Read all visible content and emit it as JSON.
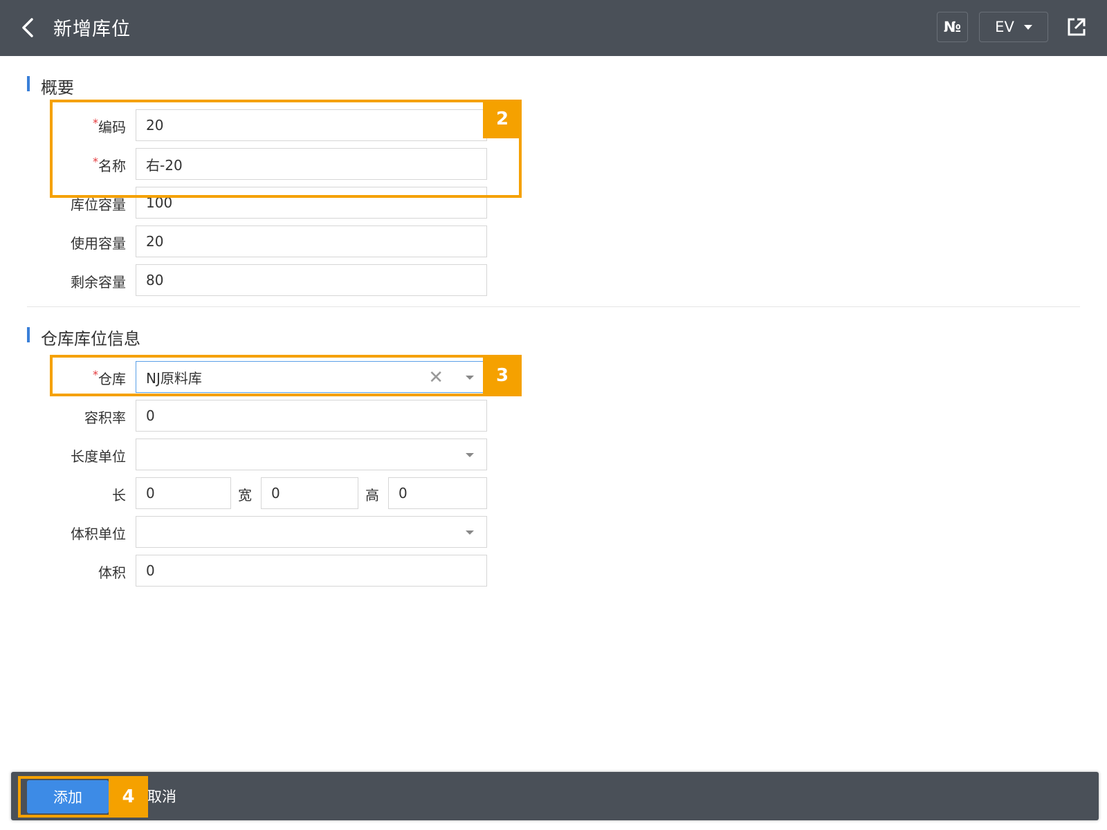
{
  "header": {
    "title": "新增库位",
    "no_button": "№",
    "ev_button": "EV",
    "back_icon": "chevron-left-icon",
    "share_icon": "share-icon"
  },
  "summary": {
    "title": "概要",
    "code": {
      "label": "编码",
      "required": "*",
      "value": "20"
    },
    "name": {
      "label": "名称",
      "required": "*",
      "value": "右-20"
    },
    "capacity": {
      "label": "库位容量",
      "value": "100"
    },
    "used_capacity": {
      "label": "使用容量",
      "value": "20"
    },
    "remaining_capacity": {
      "label": "剩余容量",
      "value": "80"
    }
  },
  "warehouse_info": {
    "title": "仓库库位信息",
    "warehouse": {
      "label": "仓库",
      "required": "*",
      "value": "NJ原料库",
      "clear": "✕"
    },
    "volume_ratio": {
      "label": "容积率",
      "value": "0"
    },
    "length_unit": {
      "label": "长度单位",
      "value": ""
    },
    "length": {
      "label": "长",
      "value": "0"
    },
    "width": {
      "label": "宽",
      "value": "0"
    },
    "height": {
      "label": "高",
      "value": "0"
    },
    "volume_unit": {
      "label": "体积单位",
      "value": ""
    },
    "volume": {
      "label": "体积",
      "value": "0"
    }
  },
  "annotations": {
    "a2": "2",
    "a3": "3",
    "a4": "4",
    "color": "#f5a100"
  },
  "footer": {
    "add_label": "添加",
    "cancel_label": "取消"
  },
  "colors": {
    "header_bg": "#4a5058",
    "primary": "#3d8be6",
    "accent_bar": "#3a7fd8",
    "required": "#e4393c"
  }
}
